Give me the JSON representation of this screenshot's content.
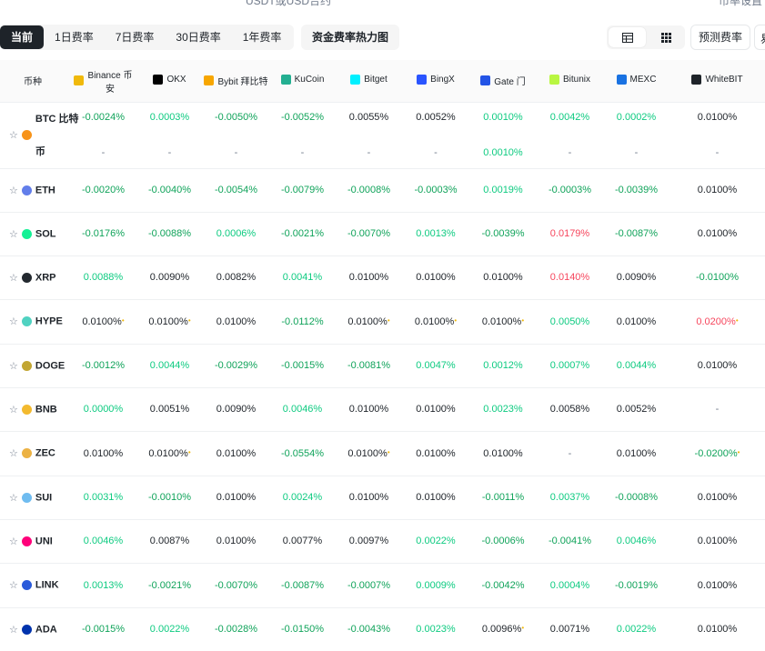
{
  "clipped_top": {
    "center": "USDT或USD合约",
    "right": "市率设置"
  },
  "toolbar": {
    "tabs": [
      "当前",
      "1日费率",
      "7日费率",
      "30日费率",
      "1年费率"
    ],
    "heatmap": "资金费率热力图",
    "predict": "预测费率"
  },
  "header": {
    "coin_col": "币种",
    "exchanges": [
      {
        "name": "Binance 币安",
        "logo_color": "#f0b90b",
        "icon": "binance-icon"
      },
      {
        "name": "OKX",
        "logo_color": "#000000",
        "icon": "okx-icon"
      },
      {
        "name": "Bybit 拜比特",
        "logo_color": "#f7a600",
        "icon": "bybit-icon"
      },
      {
        "name": "KuCoin",
        "logo_color": "#23af91",
        "icon": "kucoin-icon"
      },
      {
        "name": "Bitget",
        "logo_color": "#00f0ff",
        "icon": "bitget-icon"
      },
      {
        "name": "BingX",
        "logo_color": "#2a54ff",
        "icon": "bingx-icon"
      },
      {
        "name": "Gate 门",
        "logo_color": "#2354e6",
        "icon": "gate-icon"
      },
      {
        "name": "Bitunix",
        "logo_color": "#b9f641",
        "icon": "bitunix-icon"
      },
      {
        "name": "MEXC",
        "logo_color": "#1972e2",
        "icon": "mexc-icon"
      },
      {
        "name": "WhiteBIT",
        "logo_color": "#1e2329",
        "icon": "whitebit-icon"
      }
    ]
  },
  "rows": [
    {
      "coin": "BTC 比特币",
      "color": "#f7931a",
      "rates": [
        [
          "-0.0024%",
          "neg"
        ],
        [
          "0.0003%",
          "pos"
        ],
        [
          "-0.0050%",
          "neg"
        ],
        [
          "-0.0052%",
          "neg"
        ],
        [
          "0.0055%",
          "dk"
        ],
        [
          "0.0052%",
          "dk"
        ],
        [
          "0.0010%",
          "pos"
        ],
        [
          "0.0042%",
          "pos"
        ],
        [
          "0.0002%",
          "pos"
        ],
        [
          "0.0100%",
          "dk"
        ]
      ],
      "sub": [
        [
          "-",
          "dash"
        ],
        [
          "-",
          "dash"
        ],
        [
          "-",
          "dash"
        ],
        [
          "-",
          "dash"
        ],
        [
          "-",
          "dash"
        ],
        [
          "-",
          "dash"
        ],
        [
          "0.0010%",
          "pos"
        ],
        [
          "-",
          "dash"
        ],
        [
          "-",
          "dash"
        ],
        [
          "-",
          "dash"
        ]
      ]
    },
    {
      "coin": "ETH",
      "color": "#627eea",
      "rates": [
        [
          "-0.0020%",
          "neg"
        ],
        [
          "-0.0040%",
          "neg"
        ],
        [
          "-0.0054%",
          "neg"
        ],
        [
          "-0.0079%",
          "neg"
        ],
        [
          "-0.0008%",
          "neg"
        ],
        [
          "-0.0003%",
          "neg"
        ],
        [
          "0.0019%",
          "pos"
        ],
        [
          "-0.0003%",
          "neg"
        ],
        [
          "-0.0039%",
          "neg"
        ],
        [
          "0.0100%",
          "dk"
        ]
      ]
    },
    {
      "coin": "SOL",
      "color": "#14f195",
      "rates": [
        [
          "-0.0176%",
          "neg"
        ],
        [
          "-0.0088%",
          "neg"
        ],
        [
          "0.0006%",
          "pos"
        ],
        [
          "-0.0021%",
          "neg"
        ],
        [
          "-0.0070%",
          "neg"
        ],
        [
          "0.0013%",
          "pos"
        ],
        [
          "-0.0039%",
          "neg"
        ],
        [
          "0.0179%",
          "red"
        ],
        [
          "-0.0087%",
          "neg"
        ],
        [
          "0.0100%",
          "dk"
        ]
      ]
    },
    {
      "coin": "XRP",
      "color": "#23292f",
      "rates": [
        [
          "0.0088%",
          "pos"
        ],
        [
          "0.0090%",
          "dk"
        ],
        [
          "0.0082%",
          "dk"
        ],
        [
          "0.0041%",
          "pos"
        ],
        [
          "0.0100%",
          "dk"
        ],
        [
          "0.0100%",
          "dk"
        ],
        [
          "0.0100%",
          "dk"
        ],
        [
          "0.0140%",
          "red"
        ],
        [
          "0.0090%",
          "dk"
        ],
        [
          "-0.0100%",
          "neg"
        ]
      ]
    },
    {
      "coin": "HYPE",
      "color": "#50d2c1",
      "rates": [
        [
          "0.0100%",
          "dk",
          "m"
        ],
        [
          "0.0100%",
          "dk",
          "m"
        ],
        [
          "0.0100%",
          "dk"
        ],
        [
          "-0.0112%",
          "neg"
        ],
        [
          "0.0100%",
          "dk",
          "m"
        ],
        [
          "0.0100%",
          "dk",
          "m"
        ],
        [
          "0.0100%",
          "dk",
          "m"
        ],
        [
          "0.0050%",
          "pos"
        ],
        [
          "0.0100%",
          "dk"
        ],
        [
          "0.0200%",
          "red",
          "m"
        ]
      ]
    },
    {
      "coin": "DOGE",
      "color": "#c2a633",
      "rates": [
        [
          "-0.0012%",
          "neg"
        ],
        [
          "0.0044%",
          "pos"
        ],
        [
          "-0.0029%",
          "neg"
        ],
        [
          "-0.0015%",
          "neg"
        ],
        [
          "-0.0081%",
          "neg"
        ],
        [
          "0.0047%",
          "pos"
        ],
        [
          "0.0012%",
          "pos"
        ],
        [
          "0.0007%",
          "pos"
        ],
        [
          "0.0044%",
          "pos"
        ],
        [
          "0.0100%",
          "dk"
        ]
      ]
    },
    {
      "coin": "BNB",
      "color": "#f3ba2f",
      "rates": [
        [
          "0.0000%",
          "pos"
        ],
        [
          "0.0051%",
          "dk"
        ],
        [
          "0.0090%",
          "dk"
        ],
        [
          "0.0046%",
          "pos"
        ],
        [
          "0.0100%",
          "dk"
        ],
        [
          "0.0100%",
          "dk"
        ],
        [
          "0.0023%",
          "pos"
        ],
        [
          "0.0058%",
          "dk"
        ],
        [
          "0.0052%",
          "dk"
        ],
        [
          "-",
          "dash"
        ]
      ]
    },
    {
      "coin": "ZEC",
      "color": "#ecb244",
      "rates": [
        [
          "0.0100%",
          "dk"
        ],
        [
          "0.0100%",
          "dk",
          "m"
        ],
        [
          "0.0100%",
          "dk"
        ],
        [
          "-0.0554%",
          "neg"
        ],
        [
          "0.0100%",
          "dk",
          "m"
        ],
        [
          "0.0100%",
          "dk"
        ],
        [
          "0.0100%",
          "dk"
        ],
        [
          "-",
          "dash"
        ],
        [
          "0.0100%",
          "dk"
        ],
        [
          "-0.0200%",
          "neg",
          "m"
        ]
      ]
    },
    {
      "coin": "SUI",
      "color": "#6fbcf0",
      "rates": [
        [
          "0.0031%",
          "pos"
        ],
        [
          "-0.0010%",
          "neg"
        ],
        [
          "0.0100%",
          "dk"
        ],
        [
          "0.0024%",
          "pos"
        ],
        [
          "0.0100%",
          "dk"
        ],
        [
          "0.0100%",
          "dk"
        ],
        [
          "-0.0011%",
          "neg"
        ],
        [
          "0.0037%",
          "pos"
        ],
        [
          "-0.0008%",
          "neg"
        ],
        [
          "0.0100%",
          "dk"
        ]
      ]
    },
    {
      "coin": "UNI",
      "color": "#ff007a",
      "rates": [
        [
          "0.0046%",
          "pos"
        ],
        [
          "0.0087%",
          "dk"
        ],
        [
          "0.0100%",
          "dk"
        ],
        [
          "0.0077%",
          "dk"
        ],
        [
          "0.0097%",
          "dk"
        ],
        [
          "0.0022%",
          "pos"
        ],
        [
          "-0.0006%",
          "neg"
        ],
        [
          "-0.0041%",
          "neg"
        ],
        [
          "0.0046%",
          "pos"
        ],
        [
          "0.0100%",
          "dk"
        ]
      ]
    },
    {
      "coin": "LINK",
      "color": "#2a5ada",
      "rates": [
        [
          "0.0013%",
          "pos"
        ],
        [
          "-0.0021%",
          "neg"
        ],
        [
          "-0.0070%",
          "neg"
        ],
        [
          "-0.0087%",
          "neg"
        ],
        [
          "-0.0007%",
          "neg"
        ],
        [
          "0.0009%",
          "pos"
        ],
        [
          "-0.0042%",
          "neg"
        ],
        [
          "0.0004%",
          "pos"
        ],
        [
          "-0.0019%",
          "neg"
        ],
        [
          "0.0100%",
          "dk"
        ]
      ]
    },
    {
      "coin": "ADA",
      "color": "#0033ad",
      "rates": [
        [
          "-0.0015%",
          "neg"
        ],
        [
          "0.0022%",
          "pos"
        ],
        [
          "-0.0028%",
          "neg"
        ],
        [
          "-0.0150%",
          "neg"
        ],
        [
          "-0.0043%",
          "neg"
        ],
        [
          "0.0023%",
          "pos"
        ],
        [
          "0.0096%",
          "dk",
          "m"
        ],
        [
          "0.0071%",
          "dk"
        ],
        [
          "0.0022%",
          "pos"
        ],
        [
          "0.0100%",
          "dk"
        ]
      ]
    }
  ]
}
